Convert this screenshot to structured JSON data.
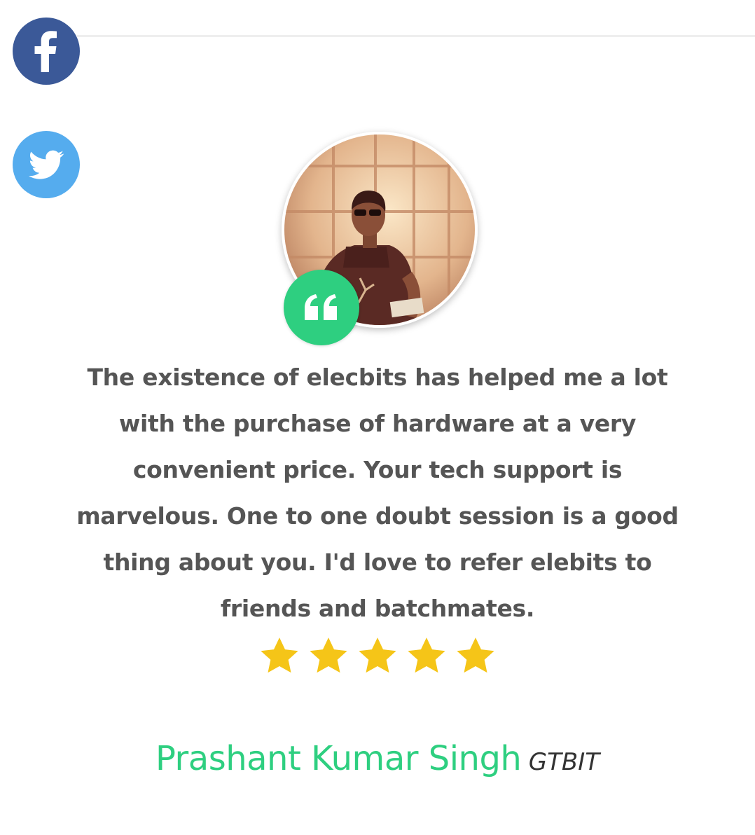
{
  "social": {
    "facebook": {
      "icon": "facebook-icon",
      "color": "#3b5998"
    },
    "twitter": {
      "icon": "twitter-icon",
      "color": "#55acee"
    }
  },
  "testimonial": {
    "text": "The existence of elecbits has helped me a lot with the purchase of hardware at a very convenient price. Your tech support is marvelous. One to one doubt session is a good thing about you. I'd love to refer elebits to friends and batchmates.",
    "rating": 5,
    "rating_max": 5,
    "star_color": "#f5c518",
    "accent_color": "#2ecf80"
  },
  "author": {
    "name": "Prashant Kumar Singh",
    "org": "GTBIT"
  }
}
